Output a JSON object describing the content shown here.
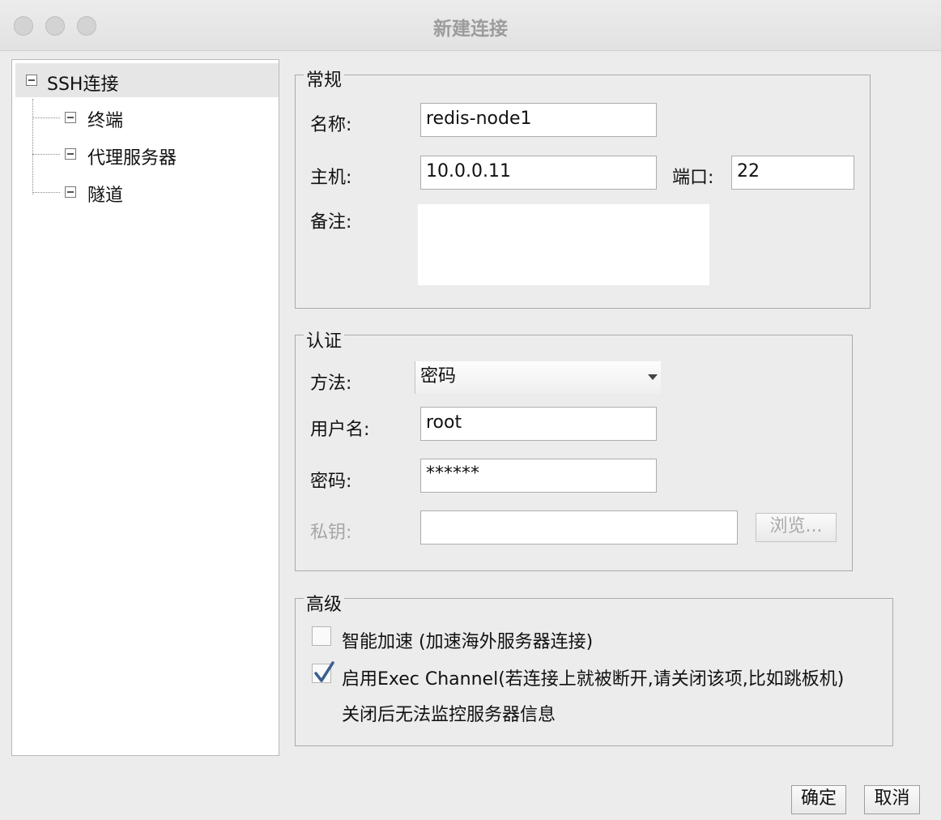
{
  "window": {
    "title": "新建连接"
  },
  "tree": {
    "root": "SSH连接",
    "children": [
      "终端",
      "代理服务器",
      "隧道"
    ]
  },
  "general": {
    "legend": "常规",
    "name_label": "名称:",
    "name_value": "redis-node1",
    "host_label": "主机:",
    "host_value": "10.0.0.11",
    "port_label": "端口:",
    "port_value": "22",
    "notes_label": "备注:",
    "notes_value": ""
  },
  "auth": {
    "legend": "认证",
    "method_label": "方法:",
    "method_value": "密码",
    "username_label": "用户名:",
    "username_value": "root",
    "password_label": "密码:",
    "password_value": "******",
    "private_key_label": "私钥:",
    "private_key_value": "",
    "browse_label": "浏览..."
  },
  "advanced": {
    "legend": "高级",
    "smart_accel_label": "智能加速 (加速海外服务器连接)",
    "smart_accel_checked": false,
    "exec_channel_label": "启用Exec Channel(若连接上就被断开,请关闭该项,比如跳板机)",
    "exec_channel_checked": true,
    "exec_channel_note": "关闭后无法监控服务器信息"
  },
  "footer": {
    "ok_label": "确定",
    "cancel_label": "取消"
  }
}
